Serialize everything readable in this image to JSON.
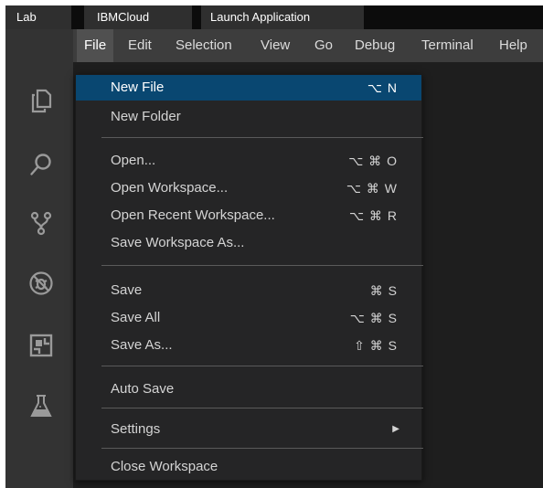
{
  "tabs": [
    {
      "label": "Lab"
    },
    {
      "label": "IBMCloud"
    },
    {
      "label": "Launch Application"
    }
  ],
  "menubar": {
    "items": [
      {
        "label": "File"
      },
      {
        "label": "Edit"
      },
      {
        "label": "Selection"
      },
      {
        "label": "View"
      },
      {
        "label": "Go"
      },
      {
        "label": "Debug"
      },
      {
        "label": "Terminal"
      },
      {
        "label": "Help"
      }
    ],
    "active": "File"
  },
  "activitybar": {
    "icons": [
      "explorer-icon",
      "search-icon",
      "source-control-icon",
      "debug-icon",
      "extensions-icon",
      "flask-icon"
    ]
  },
  "file_menu": {
    "groups": [
      [
        {
          "label": "New File",
          "shortcut": "⌥ N",
          "highlighted": true
        },
        {
          "label": "New Folder",
          "shortcut": ""
        }
      ],
      [
        {
          "label": "Open...",
          "shortcut": "⌥ ⌘ O"
        },
        {
          "label": "Open Workspace...",
          "shortcut": "⌥ ⌘ W"
        },
        {
          "label": "Open Recent Workspace...",
          "shortcut": "⌥ ⌘ R"
        },
        {
          "label": "Save Workspace As...",
          "shortcut": ""
        }
      ],
      [
        {
          "label": "Save",
          "shortcut": "⌘ S"
        },
        {
          "label": "Save All",
          "shortcut": "⌥ ⌘ S"
        },
        {
          "label": "Save As...",
          "shortcut": "⇧ ⌘ S"
        }
      ],
      [
        {
          "label": "Auto Save",
          "shortcut": ""
        }
      ],
      [
        {
          "label": "Settings",
          "shortcut": "",
          "submenu": true
        }
      ],
      [
        {
          "label": "Close Workspace",
          "shortcut": ""
        }
      ]
    ]
  },
  "colors": {
    "highlight": "#094771",
    "menu_bg": "#252526",
    "menubar_bg": "#3d3d3d",
    "activitybar_bg": "#333333",
    "tabbar_bg": "#0c0c0c"
  }
}
